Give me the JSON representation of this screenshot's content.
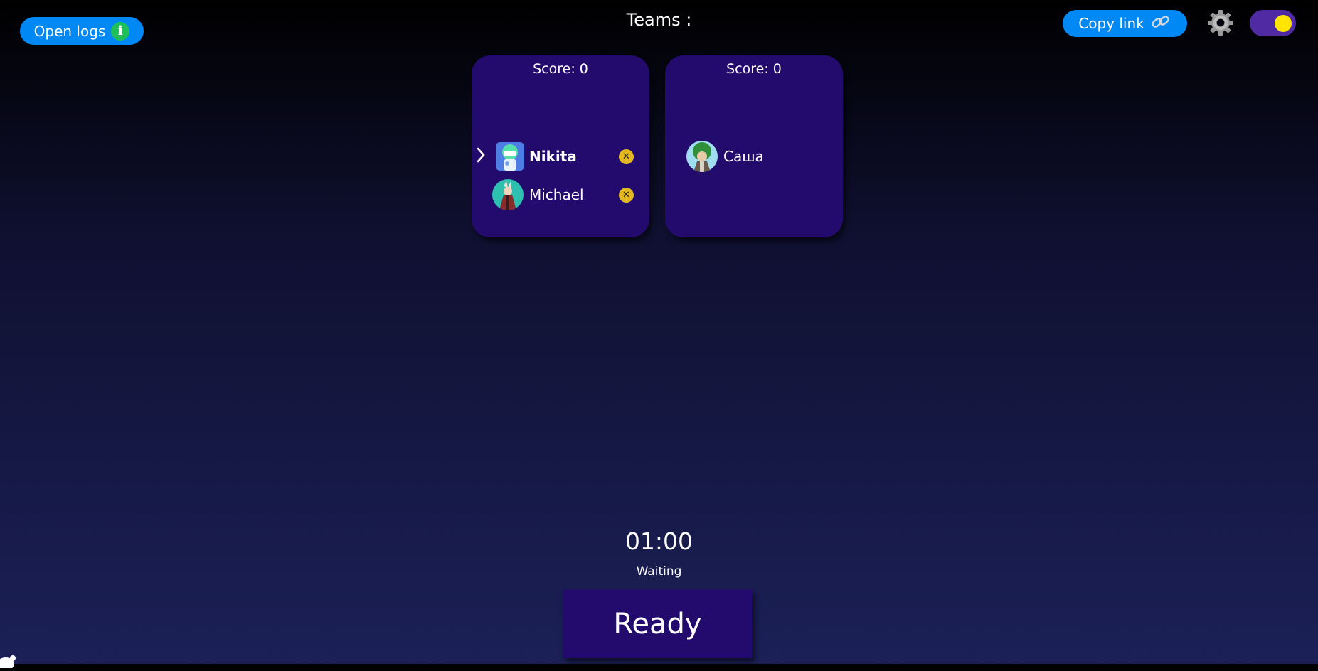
{
  "header": {
    "open_logs_label": "Open logs",
    "open_logs_icon": "info-icon",
    "title": "Teams :",
    "copy_link_label": "Copy link",
    "copy_link_icon": "link-icon",
    "settings_icon": "gear-icon",
    "theme_toggle_on": true
  },
  "teams": [
    {
      "score_label": "Score: 0",
      "members": [
        {
          "name": "Nikita",
          "current": true,
          "kick_icon": "close-icon"
        },
        {
          "name": "Michael",
          "current": false,
          "kick_icon": "close-icon"
        }
      ]
    },
    {
      "score_label": "Score: 0",
      "members": [
        {
          "name": "Саша",
          "current": false
        }
      ]
    }
  ],
  "game": {
    "timer": "01:00",
    "status": "Waiting",
    "ready_label": "Ready"
  },
  "colors": {
    "accent": "#0088f4",
    "team_card": "#230b6e",
    "toggle_track": "#4f2aa3",
    "toggle_knob": "#ffe500",
    "kick": "#e3b923",
    "info": "#1fbf5b"
  }
}
